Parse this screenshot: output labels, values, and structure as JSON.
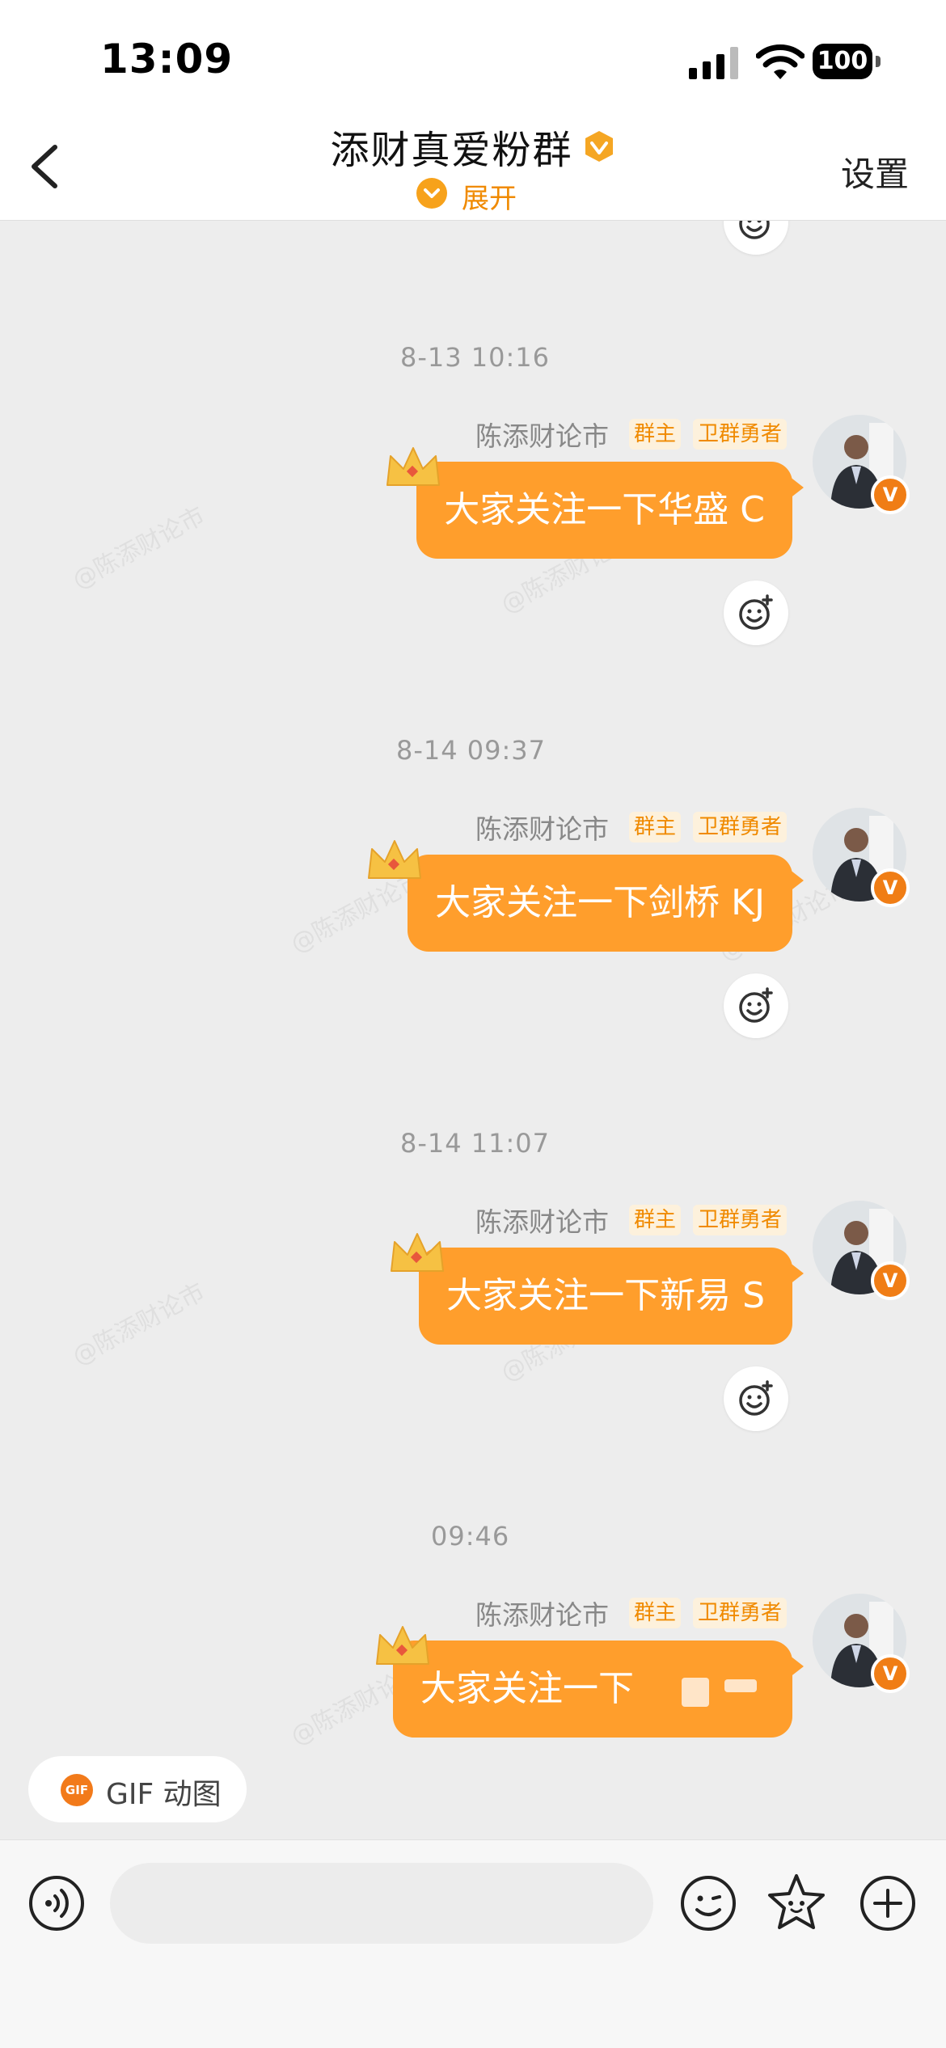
{
  "status_bar": {
    "time": "13:09",
    "battery": "100"
  },
  "header": {
    "title": "添财真爱粉群",
    "expand_label": "展开",
    "settings_label": "设置"
  },
  "watermark_text": "@陈添财论市",
  "messages": [
    {
      "time": "8-13 10:16",
      "sender": "陈添财论市",
      "tags": [
        "群主",
        "卫群勇者"
      ],
      "text": "大家关注一下华盛 C"
    },
    {
      "time": "8-14 09:37",
      "sender": "陈添财论市",
      "tags": [
        "群主",
        "卫群勇者"
      ],
      "text": "大家关注一下剑桥 KJ"
    },
    {
      "time": "8-14 11:07",
      "sender": "陈添财论市",
      "tags": [
        "群主",
        "卫群勇者"
      ],
      "text": "大家关注一下新易 S"
    },
    {
      "time": "09:46",
      "sender": "陈添财论市",
      "tags": [
        "群主",
        "卫群勇者"
      ],
      "text": "大家关注一下"
    }
  ],
  "gif_chip": {
    "icon_text": "GIF",
    "label": "GIF 动图"
  },
  "input": {
    "placeholder": "",
    "value": ""
  },
  "icons": [
    "back-icon",
    "vip-badge-icon",
    "chevron-down-icon",
    "smiley-plus-icon",
    "crown-icon",
    "voice-icon",
    "emoji-icon",
    "sticker-icon",
    "plus-icon"
  ],
  "colors": {
    "accent": "#ff9e2c",
    "tag_text": "#f08a00",
    "tag_bg": "#fdf1dc",
    "chat_bg": "#ededed"
  }
}
